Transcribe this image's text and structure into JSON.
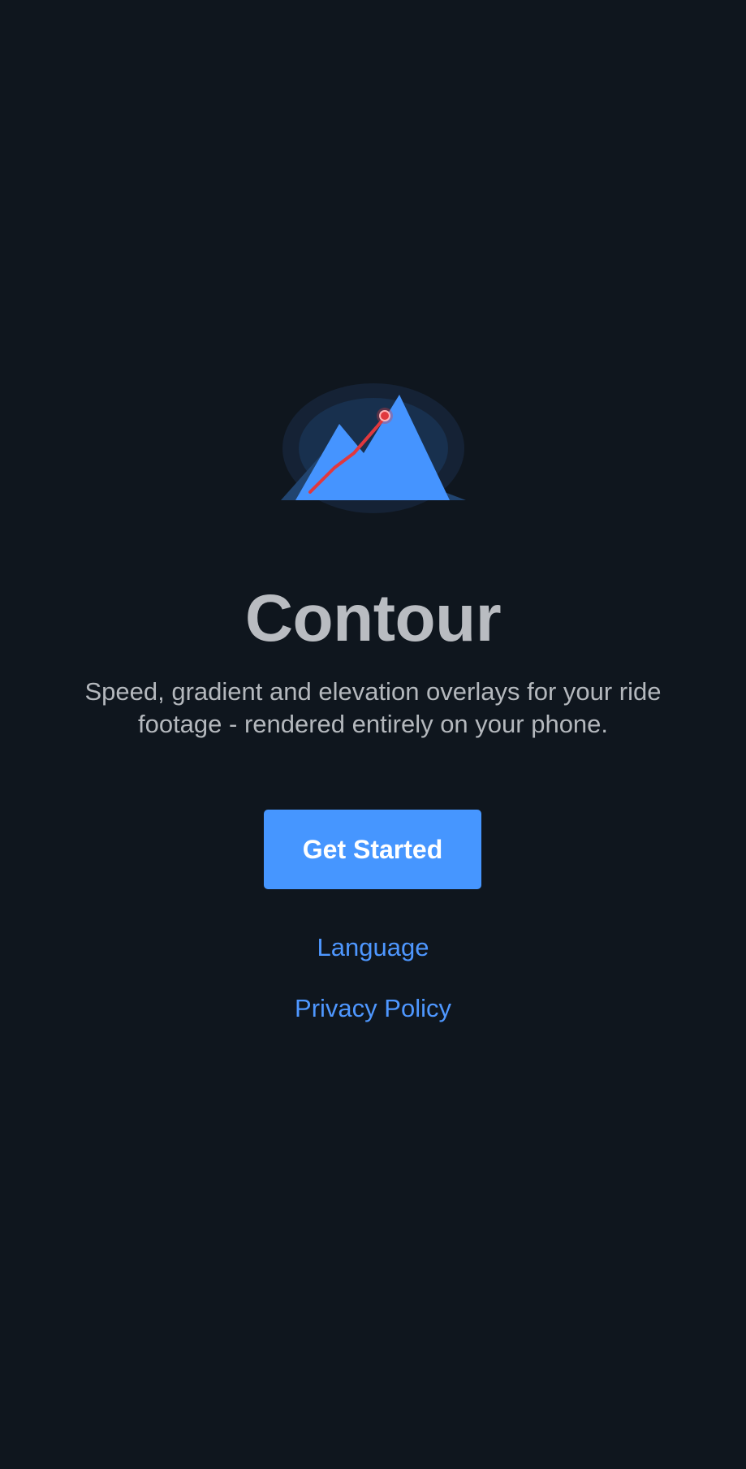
{
  "app": {
    "title": "Contour",
    "tagline": "Speed, gradient and elevation overlays for your ride footage - rendered entirely on your phone."
  },
  "logo": {
    "icon": "mountain-route-icon",
    "mountain_color": "#4594ff",
    "route_color": "#e0383e"
  },
  "actions": {
    "get_started_label": "Get Started",
    "language_label": "Language",
    "privacy_label": "Privacy Policy"
  },
  "colors": {
    "background": "#0f161e",
    "accent": "#4696ff",
    "title": "#b9bcc1",
    "body_text": "#b4b8bd"
  }
}
